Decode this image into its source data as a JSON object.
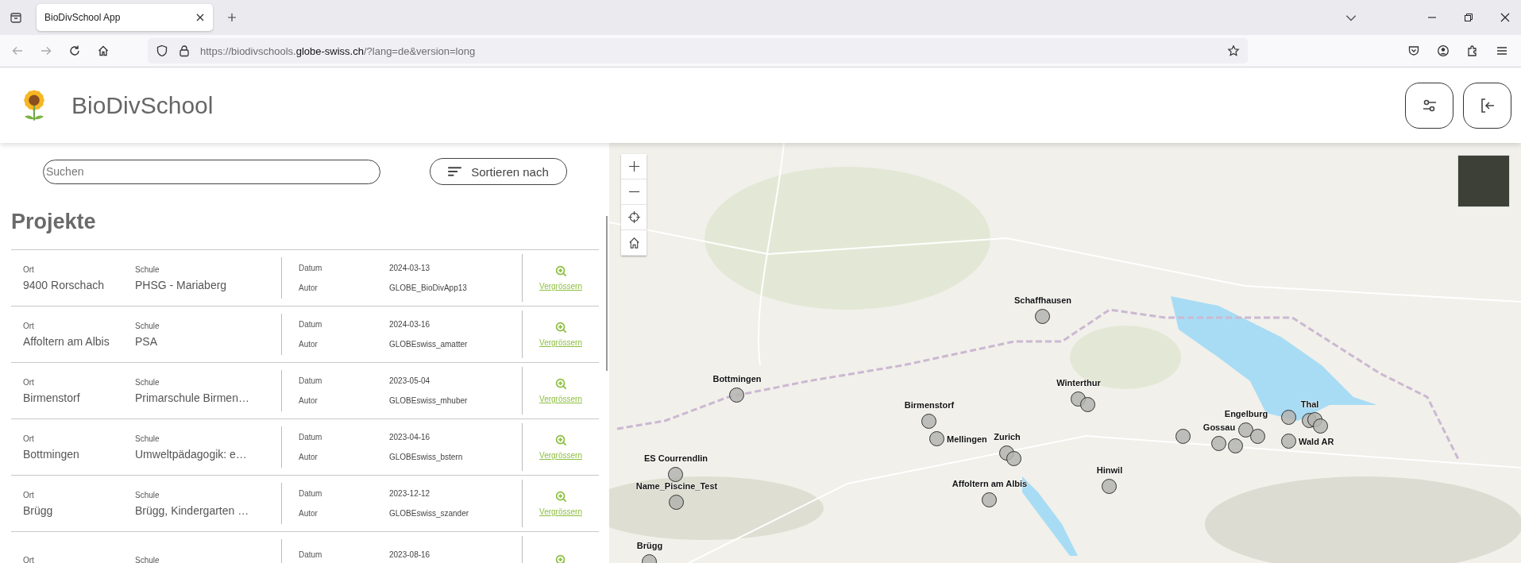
{
  "browser": {
    "tab_title": "BioDivSchool App",
    "url_start": "https://biodivschools.",
    "url_domain": "globe-swiss.ch",
    "url_end": "/?lang=de&version=long"
  },
  "header": {
    "title": "BioDivSchool"
  },
  "search": {
    "placeholder": "Suchen"
  },
  "sort_button": "Sortieren nach",
  "heading": "Projekte",
  "projects": [
    {
      "ort_label": "Ort",
      "ort": "9400 Rorschach",
      "schule_label": "Schule",
      "schule": "PHSG - Mariaberg",
      "datum_label": "Datum",
      "datum": "2024-03-13",
      "autor_label": "Autor",
      "autor": "GLOBE_BioDivApp13",
      "action": "Vergrössern"
    },
    {
      "ort_label": "Ort",
      "ort": "Affoltern am Albis",
      "schule_label": "Schule",
      "schule": "PSA",
      "datum_label": "Datum",
      "datum": "2024-03-16",
      "autor_label": "Autor",
      "autor": "GLOBEswiss_amatter",
      "action": "Vergrössern"
    },
    {
      "ort_label": "Ort",
      "ort": "Birmenstorf",
      "schule_label": "Schule",
      "schule": "Primarschule Birmen…",
      "datum_label": "Datum",
      "datum": "2023-05-04",
      "autor_label": "Autor",
      "autor": "GLOBEswiss_mhuber",
      "action": "Vergrössern"
    },
    {
      "ort_label": "Ort",
      "ort": "Bottmingen",
      "schule_label": "Schule",
      "schule": "Umweltpädagogik: e…",
      "datum_label": "Datum",
      "datum": "2023-04-16",
      "autor_label": "Autor",
      "autor": "GLOBEswiss_bstern",
      "action": "Vergrössern"
    },
    {
      "ort_label": "Ort",
      "ort": "Brügg",
      "schule_label": "Schule",
      "schule": "Brügg, Kindergarten …",
      "datum_label": "Datum",
      "datum": "2023-12-12",
      "autor_label": "Autor",
      "autor": "GLOBEswiss_szander",
      "action": "Vergrössern"
    },
    {
      "ort_label": "Ort",
      "schule_label": "Schule",
      "datum_label": "Datum",
      "datum": "2023-08-16"
    }
  ],
  "map_markers": [
    {
      "kind": "labeled",
      "label": "Schaffhausen"
    },
    {
      "kind": "labeled",
      "label": "Bottmingen"
    },
    {
      "kind": "labeled",
      "label": "Winterthur"
    },
    {
      "kind": "plain"
    },
    {
      "kind": "labeled",
      "label": "Birmenstorf"
    },
    {
      "kind": "labeled",
      "label": "Mellingen"
    },
    {
      "kind": "labeled",
      "label": "Zurich"
    },
    {
      "kind": "plain"
    },
    {
      "kind": "labeled",
      "label": "ES Courrendlin"
    },
    {
      "kind": "labeled",
      "label": "Name_Piscine_Test"
    },
    {
      "kind": "labeled",
      "label": "Affoltern am Albis"
    },
    {
      "kind": "labeled",
      "label": "Hinwil"
    },
    {
      "kind": "plain"
    },
    {
      "kind": "labeled",
      "label": "Engelburg"
    },
    {
      "kind": "plain"
    },
    {
      "kind": "labeled",
      "label": "Gossau"
    },
    {
      "kind": "plain"
    },
    {
      "kind": "plain"
    },
    {
      "kind": "labeled",
      "label": "Thal"
    },
    {
      "kind": "plain"
    },
    {
      "kind": "plain"
    },
    {
      "kind": "labeled",
      "label": "Wald AR"
    },
    {
      "kind": "labeled",
      "label": "Brügg"
    }
  ]
}
